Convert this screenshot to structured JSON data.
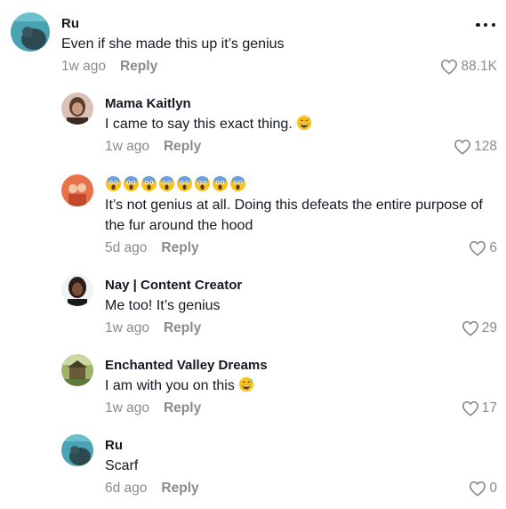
{
  "comments": [
    {
      "username": "Ru",
      "text": "Even if she made this up it’s genius",
      "time": "1w ago",
      "reply_label": "Reply",
      "likes": "88.1K",
      "avatar_colors": [
        "#4aa3b4",
        "#2d4a52"
      ]
    },
    {
      "username": "Mama Kaitlyn",
      "text": "I came to say this exact thing.",
      "emoji": "grinning-sweat",
      "time": "1w ago",
      "reply_label": "Reply",
      "likes": "128",
      "avatar_colors": [
        "#d9c1b5",
        "#5a3a2c"
      ]
    },
    {
      "username_emoji_count": 8,
      "username_emoji": "face-screaming-in-fear",
      "text": "It’s not genius at all. Doing this defeats the entire purpose of the fur around the hood",
      "time": "5d ago",
      "reply_label": "Reply",
      "likes": "6",
      "avatar_colors": [
        "#e8734a",
        "#c4482a"
      ]
    },
    {
      "username": "Nay | Content Creator",
      "text": "Me too! It’s genius",
      "time": "1w ago",
      "reply_label": "Reply",
      "likes": "29",
      "avatar_colors": [
        "#f2f2f2",
        "#2a1d18"
      ]
    },
    {
      "username": "Enchanted Valley Dreams",
      "text": "I am with you on this",
      "emoji": "grinning-sweat",
      "time": "1w ago",
      "reply_label": "Reply",
      "likes": "17",
      "avatar_colors": [
        "#9fb36b",
        "#6b5a3a"
      ]
    },
    {
      "username": "Ru",
      "text": "Scarf",
      "time": "6d ago",
      "reply_label": "Reply",
      "likes": "0",
      "avatar_colors": [
        "#4aa3b4",
        "#2d4a52"
      ]
    }
  ],
  "icons": {
    "more": "more-options-icon",
    "like": "heart-outline-icon"
  },
  "colors": {
    "text": "#161823",
    "secondary": "#8a8b91",
    "emoji_yellow": "#fcc21b"
  }
}
